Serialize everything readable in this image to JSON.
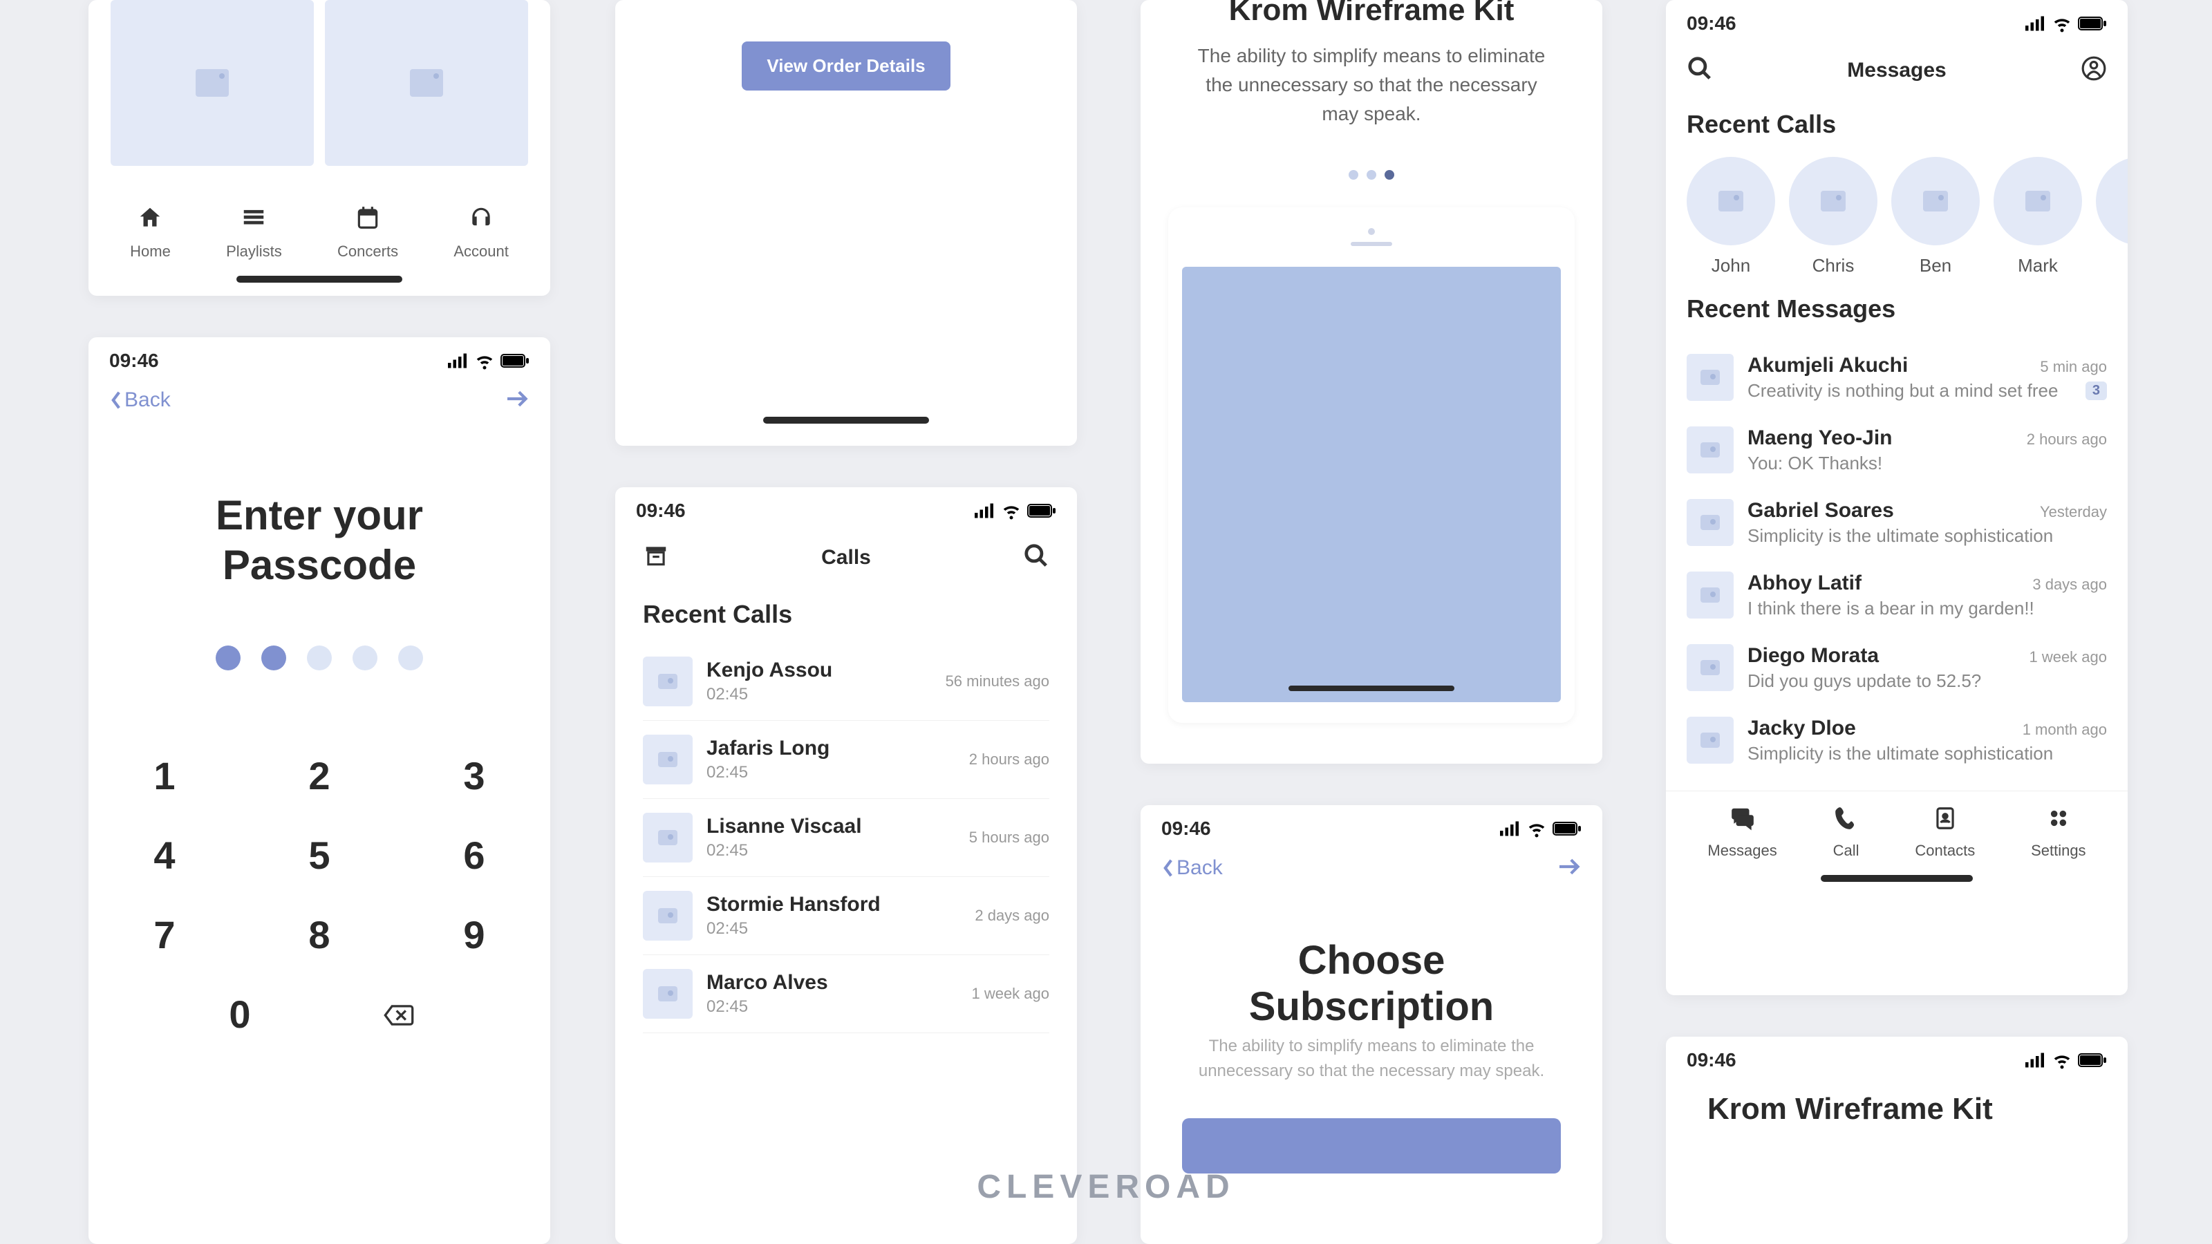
{
  "status": {
    "time": "09:46"
  },
  "p1": {
    "tabs": [
      "Home",
      "Playlists",
      "Concerts",
      "Account"
    ]
  },
  "p2": {
    "button": "View Order Details"
  },
  "p3": {
    "title": "Krom Wireframe Kit",
    "body": "The ability to simplify means to eliminate the unnecessary so that the necessary may speak."
  },
  "p4": {
    "header": "Messages",
    "recent_calls_title": "Recent Calls",
    "recent_messages_title": "Recent Messages",
    "recent": [
      {
        "name": "John"
      },
      {
        "name": "Chris"
      },
      {
        "name": "Ben"
      },
      {
        "name": "Mark"
      }
    ],
    "messages": [
      {
        "name": "Akumjeli Akuchi",
        "time": "5 min ago",
        "text": "Creativity is nothing but a mind set free",
        "badge": "3"
      },
      {
        "name": "Maeng Yeo-Jin",
        "time": "2 hours ago",
        "text": "You: OK Thanks!",
        "badge": ""
      },
      {
        "name": "Gabriel Soares",
        "time": "Yesterday",
        "text": "Simplicity is the ultimate sophistication",
        "badge": ""
      },
      {
        "name": "Abhoy Latif",
        "time": "3 days ago",
        "text": "I think there is a bear in my garden!!",
        "badge": ""
      },
      {
        "name": "Diego Morata",
        "time": "1 week ago",
        "text": "Did you guys update to 52.5?",
        "badge": ""
      },
      {
        "name": "Jacky Dloe",
        "time": "1 month ago",
        "text": "Simplicity is the ultimate sophistication",
        "badge": ""
      }
    ],
    "tabs": [
      "Messages",
      "Call",
      "Contacts",
      "Settings"
    ]
  },
  "p5": {
    "back": "Back",
    "title_l1": "Enter your",
    "title_l2": "Passcode",
    "keys": [
      "1",
      "2",
      "3",
      "4",
      "5",
      "6",
      "7",
      "8",
      "9",
      "0"
    ]
  },
  "p6": {
    "header": "Calls",
    "section": "Recent Calls",
    "calls": [
      {
        "name": "Kenjo Assou",
        "dur": "02:45",
        "time": "56 minutes ago"
      },
      {
        "name": "Jafaris Long",
        "dur": "02:45",
        "time": "2 hours ago"
      },
      {
        "name": "Lisanne Viscaal",
        "dur": "02:45",
        "time": "5 hours ago"
      },
      {
        "name": "Stormie Hansford",
        "dur": "02:45",
        "time": "2 days ago"
      },
      {
        "name": "Marco Alves",
        "dur": "02:45",
        "time": "1 week ago"
      }
    ]
  },
  "p7": {
    "back": "Back",
    "title_l1": "Choose",
    "title_l2": "Subscription",
    "body": "The ability to simplify means to eliminate the unnecessary so that the necessary may speak."
  },
  "p8": {
    "title": "Krom Wireframe Kit"
  },
  "watermark": "CLEVEROAD"
}
